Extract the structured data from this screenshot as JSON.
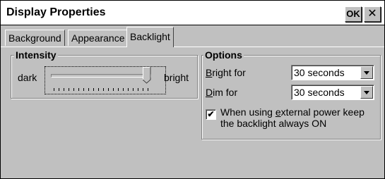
{
  "window": {
    "title": "Display Properties",
    "ok_label": "OK",
    "close_glyph": "✕"
  },
  "tabs": [
    {
      "label": "Background",
      "active": false
    },
    {
      "label": "Appearance",
      "active": false
    },
    {
      "label": "Backlight",
      "active": true
    }
  ],
  "intensity": {
    "legend": "Intensity",
    "min_label": "dark",
    "max_label": "bright",
    "value_fraction": 1.0
  },
  "options": {
    "legend": "Options",
    "bright_for": {
      "label_accel": "B",
      "label_rest": "right for",
      "value": "30 seconds"
    },
    "dim_for": {
      "label_accel": "D",
      "label_rest": "im for",
      "value": "30 seconds"
    },
    "external_power": {
      "checked": true,
      "check_glyph": "✔",
      "label_before": "When using ",
      "label_accel": "e",
      "label_after": "xternal power keep the backlight always ON"
    }
  }
}
